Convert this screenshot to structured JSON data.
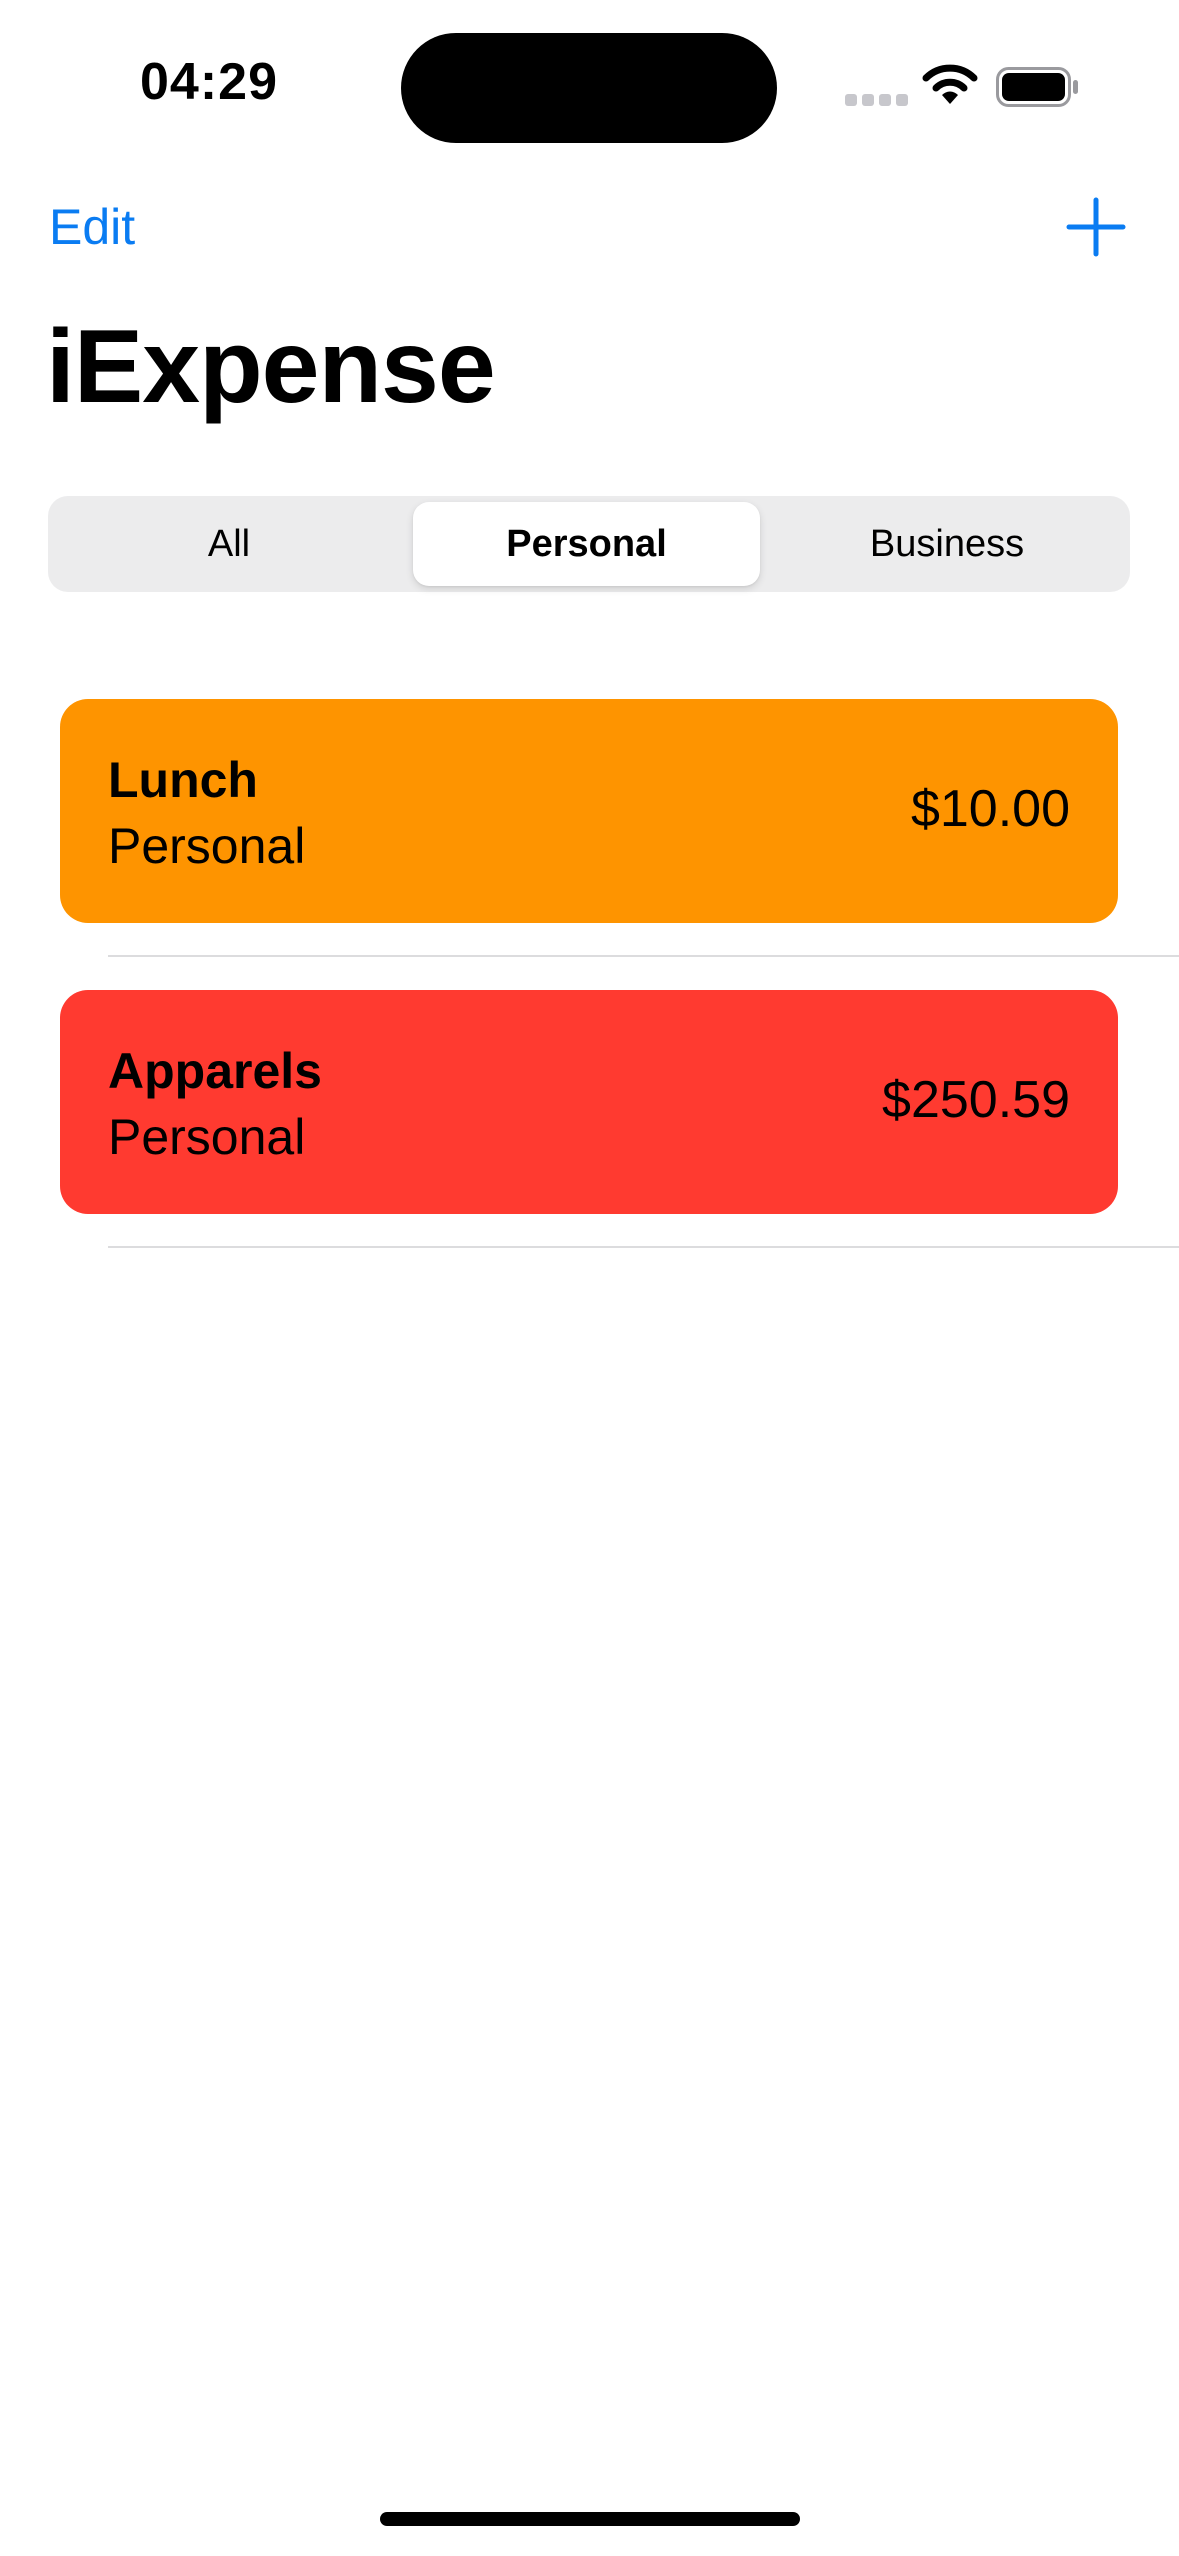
{
  "status_bar": {
    "time": "04:29",
    "icons": [
      "cellular-signal-icon",
      "wifi-icon",
      "battery-icon"
    ]
  },
  "nav": {
    "edit_label": "Edit",
    "add_icon": "plus-icon",
    "title": "iExpense"
  },
  "filter": {
    "segments": [
      "All",
      "Personal",
      "Business"
    ],
    "selected": "Personal"
  },
  "expenses": [
    {
      "name": "Lunch",
      "type": "Personal",
      "amount": "$10.00",
      "color": "#fe9400"
    },
    {
      "name": "Apparels",
      "type": "Personal",
      "amount": "$250.59",
      "color": "#ff3a30"
    }
  ],
  "colors": {
    "accent": "#0a7cf2",
    "segment_background": "#ececed"
  }
}
